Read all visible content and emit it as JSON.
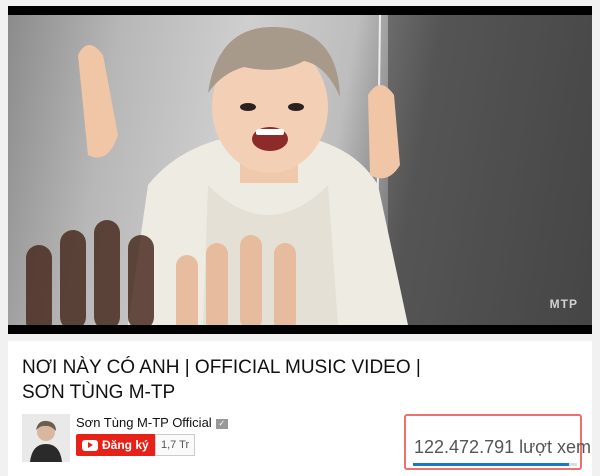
{
  "video": {
    "title": "NƠI NÀY CÓ ANH | OFFICIAL MUSIC VIDEO | SƠN TÙNG M-TP",
    "watermark": "MTP"
  },
  "channel": {
    "name": "Sơn Tùng M-TP Official",
    "verified_icon": "verified-icon",
    "subscribe_label": "Đăng ký",
    "subscriber_count": "1,7 Tr"
  },
  "stats": {
    "view_count": "122.472.791",
    "view_suffix": "lượt xem",
    "like_ratio": 0.95
  },
  "colors": {
    "subscribe_red": "#e62117",
    "like_bar_blue": "#167ac6",
    "highlight_border": "#ef6f6f"
  }
}
